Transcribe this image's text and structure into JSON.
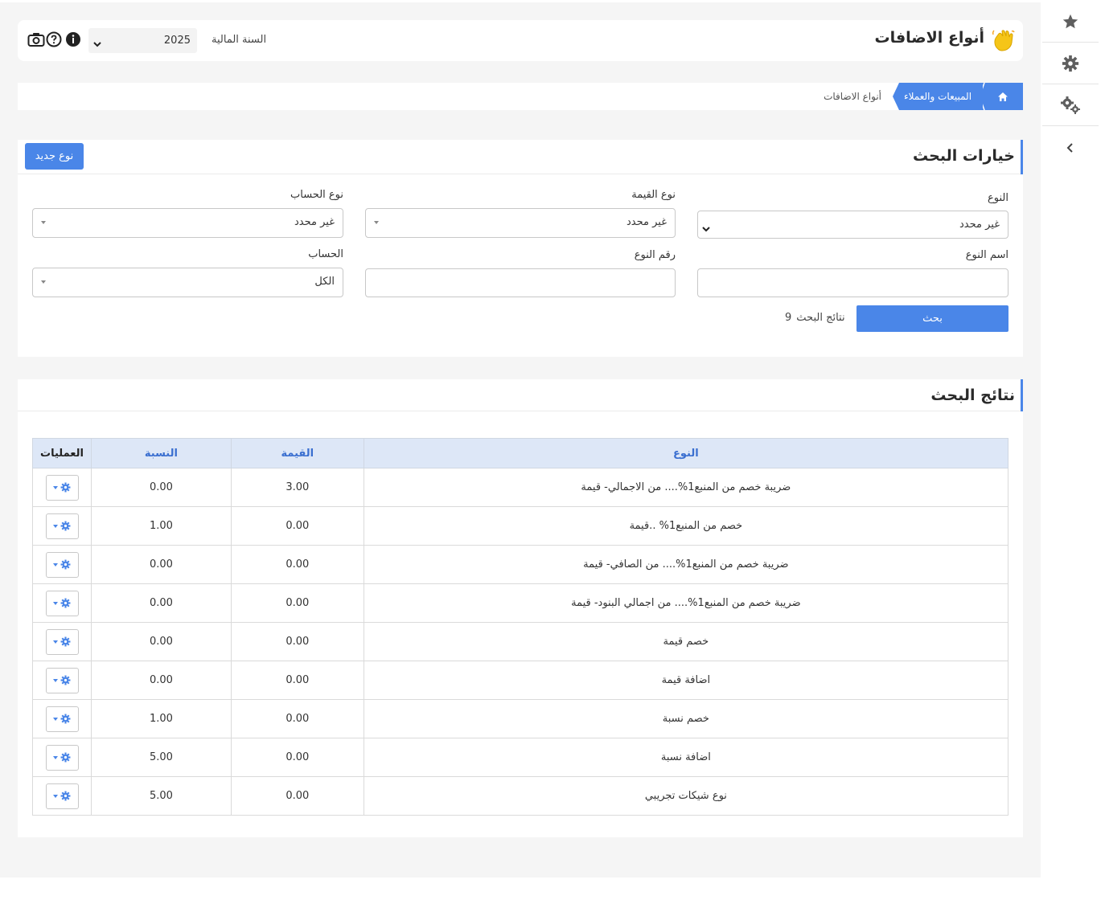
{
  "header": {
    "page_title": "أنواع الاضافات",
    "fiscal_year_label": "السنة المالية",
    "fiscal_year_value": "2025"
  },
  "breadcrumb": {
    "section": "المبيعات والعملاء",
    "current": "أنواع الاضافات"
  },
  "search_options": {
    "title": "خيارات البحث",
    "new_type_button": "نوع جديد",
    "type_label": "النوع",
    "type_value": "غير محدد",
    "value_type_label": "نوع القيمة",
    "value_type_value": "غير محدد",
    "account_type_label": "نوع الحساب",
    "account_type_value": "غير محدد",
    "type_name_label": "اسم النوع",
    "type_name_value": "",
    "type_number_label": "رقم النوع",
    "type_number_value": "",
    "account_label": "الحساب",
    "account_value": "الكل",
    "search_button": "بحث",
    "results_label": "نتائج البحث",
    "results_count": "9"
  },
  "results": {
    "title": "نتائج البحث",
    "columns": {
      "type": "النوع",
      "value": "القيمة",
      "percent": "النسبة",
      "operations": "العمليات"
    },
    "rows": [
      {
        "type": "ضريبة خصم من المنبع1%.... من الاجمالي- قيمة",
        "value": "3.00",
        "percent": "0.00"
      },
      {
        "type": "خصم من المنبع1% ..قيمة",
        "value": "0.00",
        "percent": "1.00"
      },
      {
        "type": "ضريبة خصم من المنبع1%.... من الصافي- قيمة",
        "value": "0.00",
        "percent": "0.00"
      },
      {
        "type": "ضريبة خصم من المنبع1%.... من اجمالي البنود- قيمة",
        "value": "0.00",
        "percent": "0.00"
      },
      {
        "type": "خصم قيمة",
        "value": "0.00",
        "percent": "0.00"
      },
      {
        "type": "اضافة قيمة",
        "value": "0.00",
        "percent": "0.00"
      },
      {
        "type": "خصم نسبة",
        "value": "0.00",
        "percent": "1.00"
      },
      {
        "type": "اضافة نسبة",
        "value": "0.00",
        "percent": "5.00"
      },
      {
        "type": "نوع شيكات تجريبي",
        "value": "0.00",
        "percent": "5.00"
      }
    ]
  },
  "icons": {
    "rail": [
      "star-icon",
      "gear-icon",
      "gears-icon",
      "chevron-left-icon"
    ],
    "header": [
      "camera-icon",
      "help-icon",
      "info-icon",
      "wave-icon"
    ]
  },
  "colors": {
    "accent": "#4a86e8",
    "table_header_bg": "#dde7f7",
    "background": "#f5f5f5"
  }
}
